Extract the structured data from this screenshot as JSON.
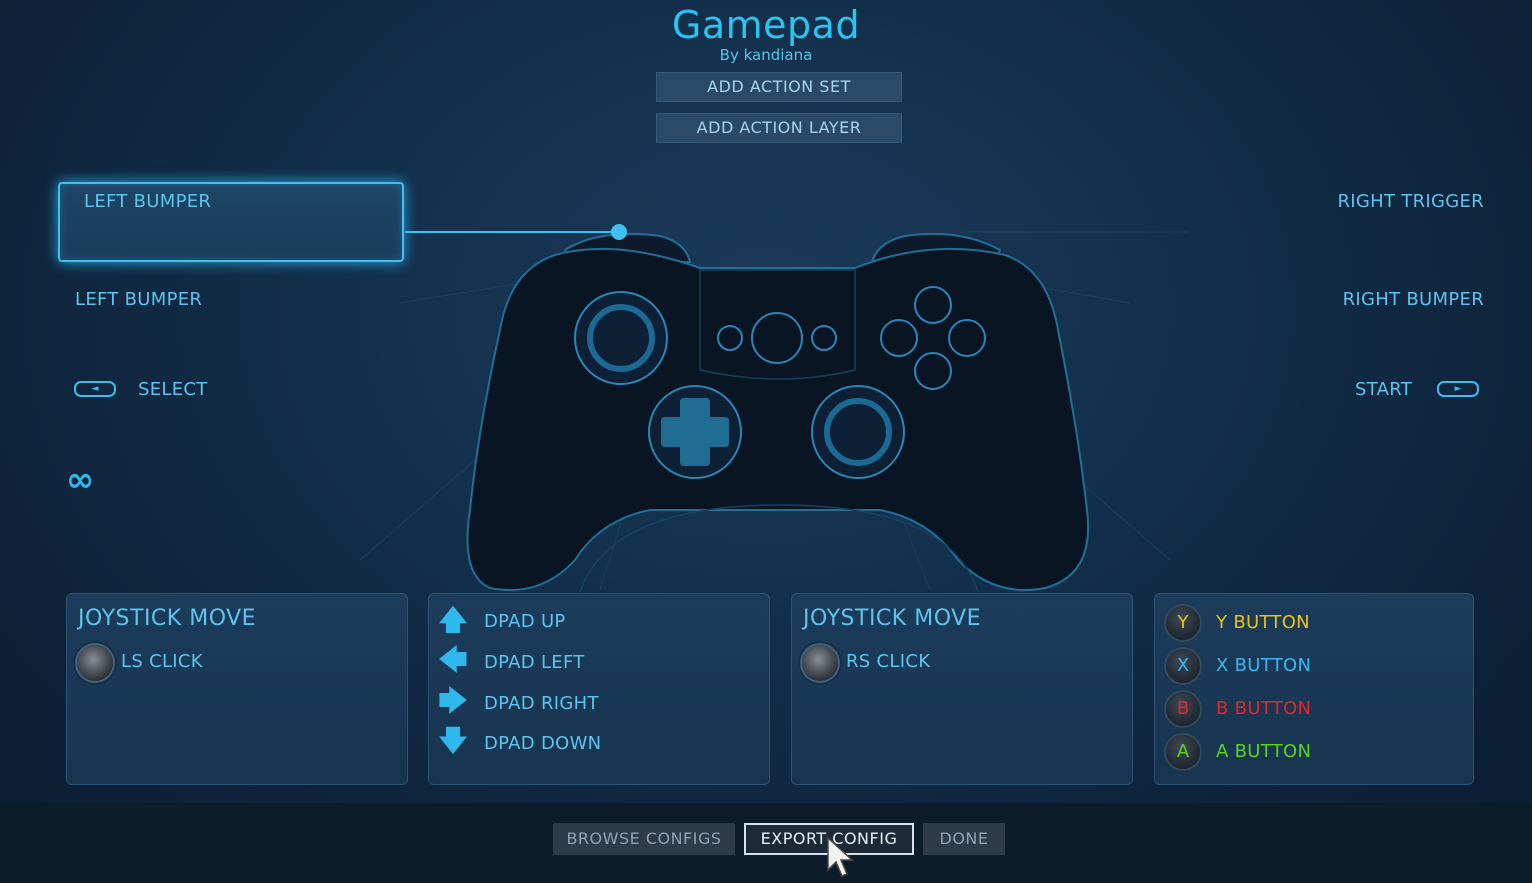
{
  "header": {
    "title": "Gamepad",
    "subtitle": "By kandiana",
    "add_action_set": "ADD ACTION SET",
    "add_action_layer": "ADD ACTION LAYER"
  },
  "left": {
    "highlighted_label": "LEFT BUMPER",
    "bumper_label": "LEFT BUMPER",
    "select_label": "SELECT",
    "infinity_icon": "∞"
  },
  "right": {
    "trigger_label": "RIGHT TRIGGER",
    "bumper_label": "RIGHT BUMPER",
    "start_label": "START"
  },
  "icons": {
    "select_glyph": "◄",
    "start_glyph": "►",
    "arrow_up": "🡅",
    "arrow_left": "🡄",
    "arrow_right": "🡆",
    "arrow_down": "🡇"
  },
  "panels": {
    "left_stick": {
      "title": "JOYSTICK MOVE",
      "click_label": "LS CLICK"
    },
    "dpad": {
      "up": "DPAD UP",
      "left": "DPAD LEFT",
      "right": "DPAD RIGHT",
      "down": "DPAD DOWN"
    },
    "right_stick": {
      "title": "JOYSTICK MOVE",
      "click_label": "RS CLICK"
    },
    "face_buttons": [
      {
        "letter": "Y",
        "label": "Y BUTTON",
        "color": "#e8c21a"
      },
      {
        "letter": "X",
        "label": "X BUTTON",
        "color": "#3ab6f0"
      },
      {
        "letter": "B",
        "label": "B BUTTON",
        "color": "#e3262b"
      },
      {
        "letter": "A",
        "label": "A BUTTON",
        "color": "#5ad21e"
      }
    ]
  },
  "footer": {
    "browse_configs": "BROWSE CONFIGS",
    "export_config": "EXPORT CONFIG",
    "done": "DONE"
  },
  "colors": {
    "accent": "#29c4f2",
    "label": "#5cc4ee",
    "controller_fill": "#0a1524",
    "controller_stroke": "#1f6f98"
  }
}
